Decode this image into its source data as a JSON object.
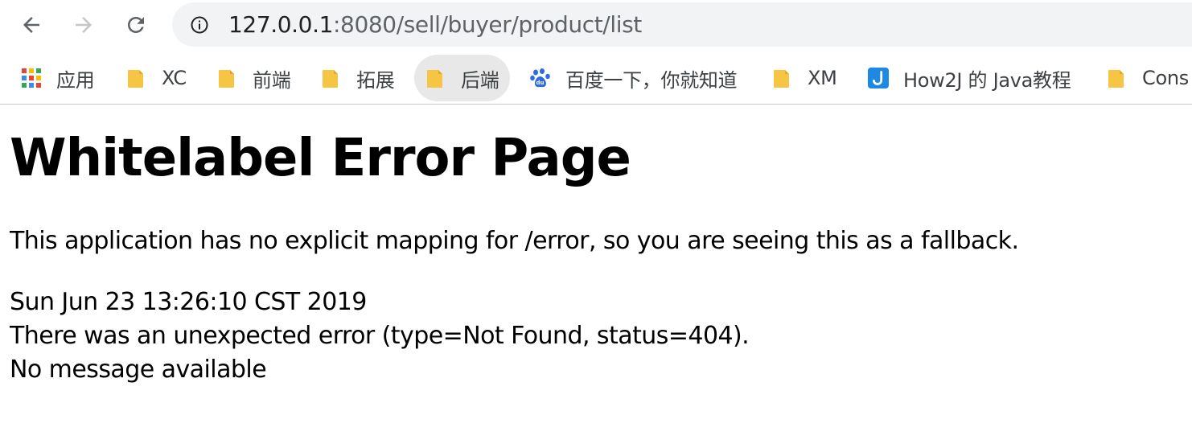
{
  "browser": {
    "nav": {
      "back_icon": "back-arrow-icon",
      "forward_icon": "forward-arrow-icon",
      "reload_icon": "reload-icon"
    },
    "address": {
      "host": "127.0.0.1",
      "rest": ":8080/sell/buyer/product/list",
      "info_icon": "info-icon"
    },
    "bookmarks": [
      {
        "label": "应用",
        "icon": "apps-grid-icon"
      },
      {
        "label": "XC",
        "icon": "folder-icon"
      },
      {
        "label": "前端",
        "icon": "folder-icon"
      },
      {
        "label": "拓展",
        "icon": "folder-icon"
      },
      {
        "label": "后端",
        "icon": "folder-icon",
        "active": true
      },
      {
        "label": "百度一下，你就知道",
        "icon": "baidu-paw-icon"
      },
      {
        "label": "XM",
        "icon": "folder-icon"
      },
      {
        "label": "How2J 的 Java教程",
        "icon": "how2j-logo-icon"
      },
      {
        "label": "Cons",
        "icon": "folder-icon"
      }
    ],
    "colors": {
      "omnibox_bg": "#f1f3f4",
      "folder": "#f6c544",
      "baidu_blue": "#2d6be4",
      "how2j_blue": "#1e88e5"
    }
  },
  "page": {
    "title": "Whitelabel Error Page",
    "message": "This application has no explicit mapping for /error, so you are seeing this as a fallback.",
    "timestamp": "Sun Jun 23 13:26:10 CST 2019",
    "error_line": "There was an unexpected error (type=Not Found, status=404).",
    "detail": "No message available"
  }
}
